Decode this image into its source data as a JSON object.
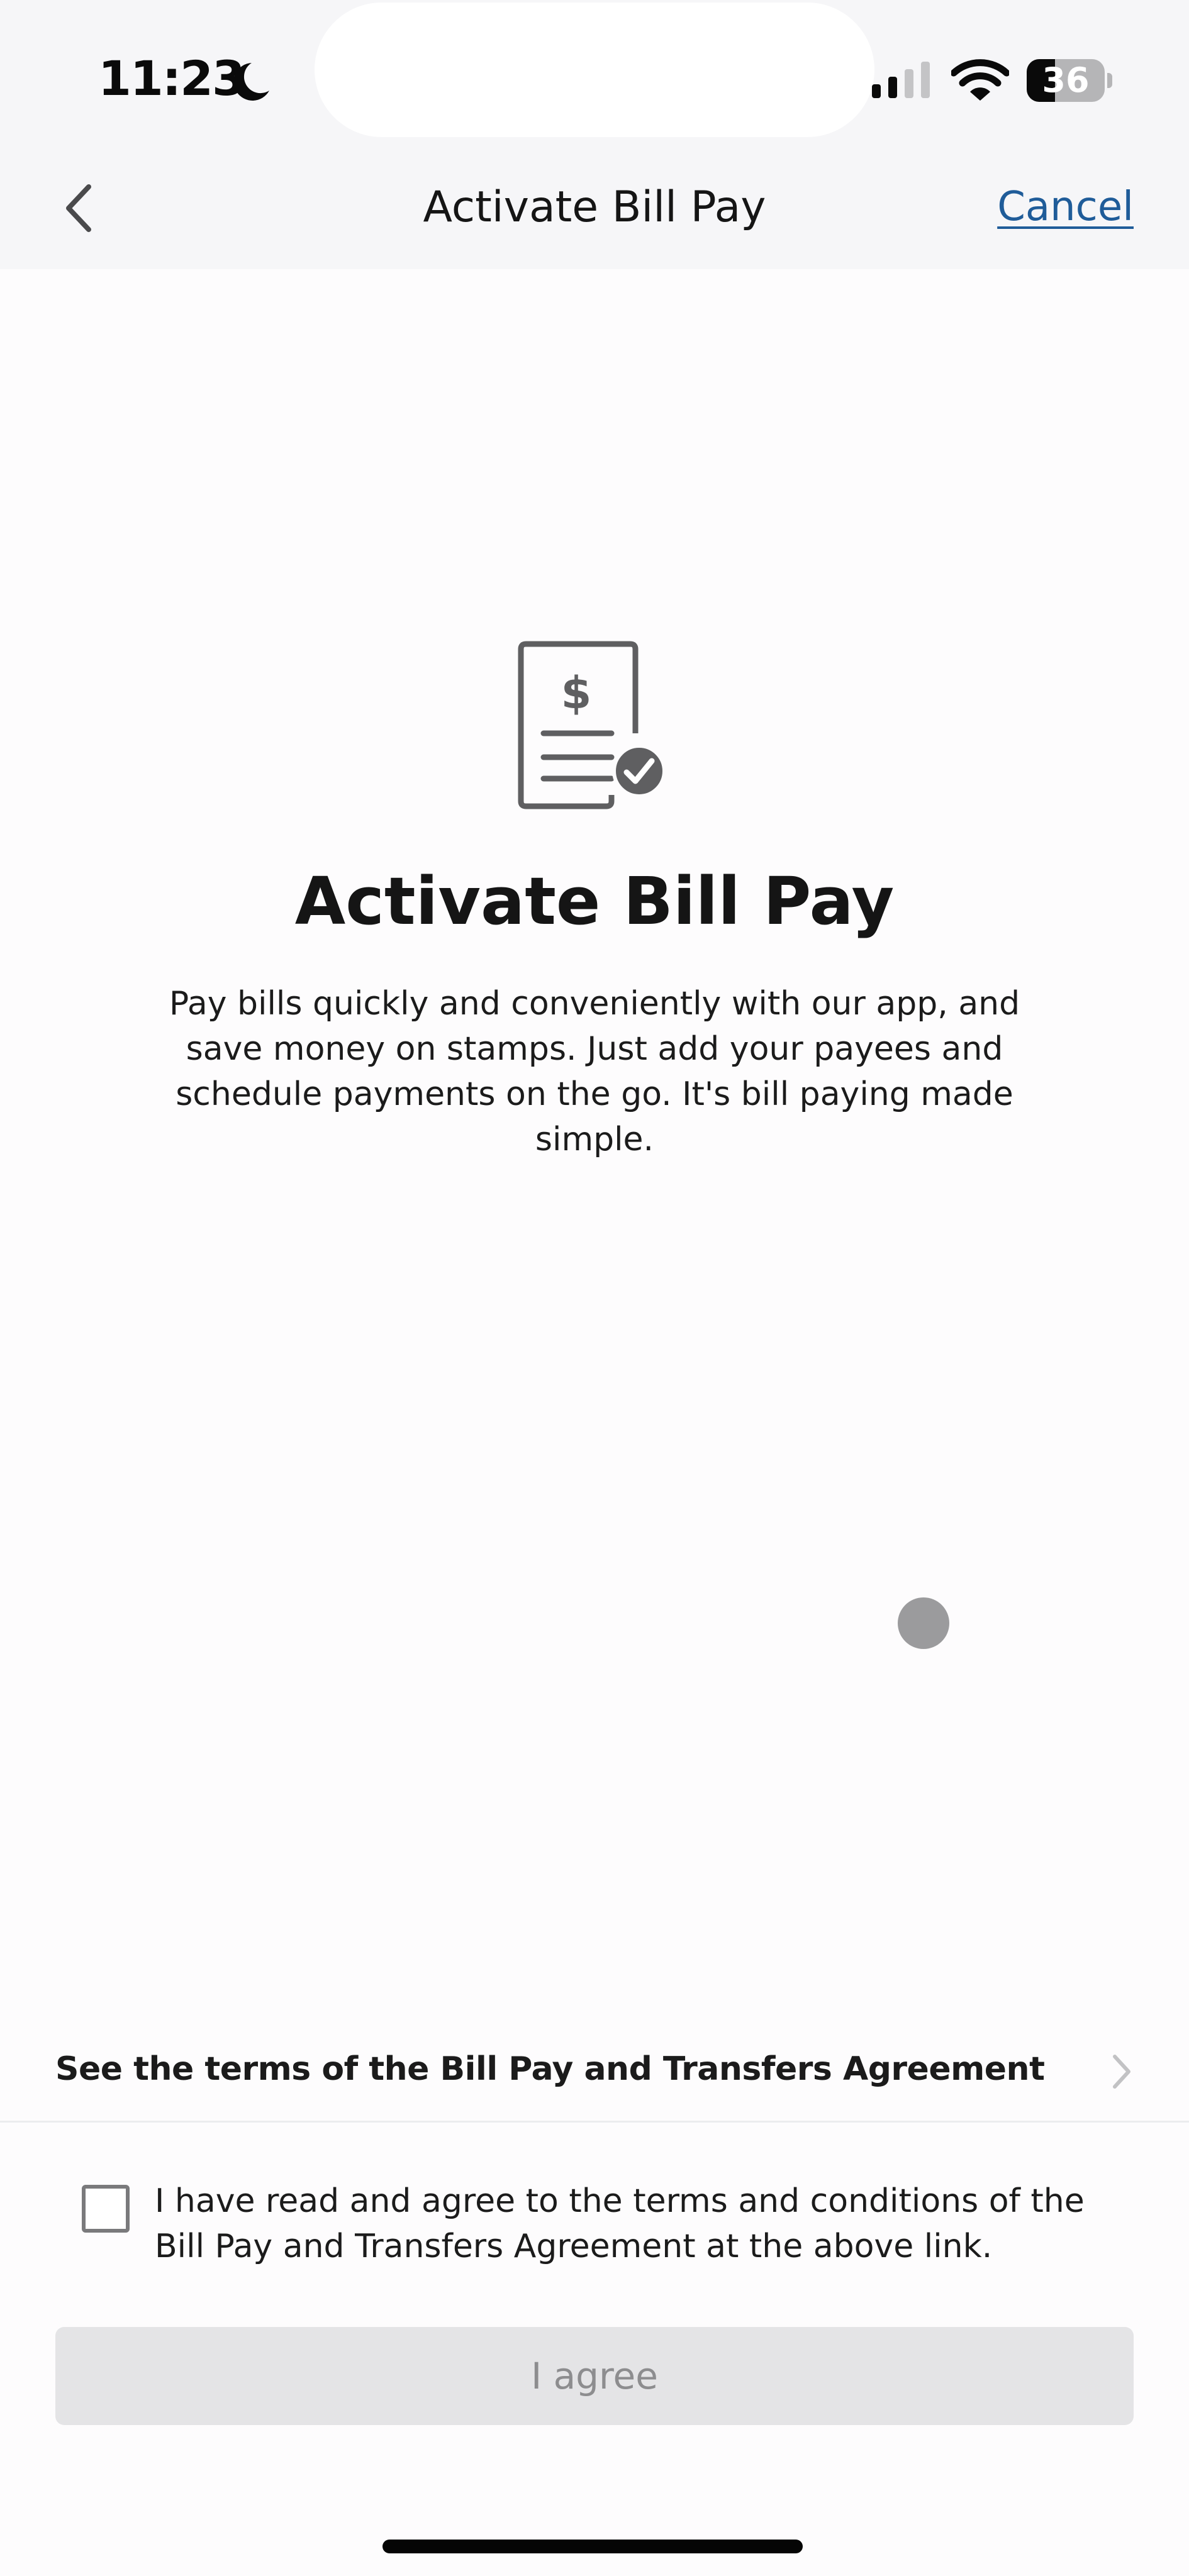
{
  "status_bar": {
    "time": "11:23",
    "focus_mode_icon": "moon-icon",
    "signal_bars_active": 2,
    "signal_bars_total": 4,
    "wifi_icon": "wifi-icon",
    "battery_percent": 36,
    "battery_label": "36"
  },
  "header": {
    "back_icon": "chevron-left-icon",
    "title": "Activate Bill Pay",
    "cancel_label": "Cancel"
  },
  "hero": {
    "icon": "bill-check-icon",
    "title": "Activate Bill Pay",
    "description": "Pay bills quickly and conveniently with our app, and save money on stamps. Just add your payees and schedule payments on the go. It's bill paying made simple."
  },
  "terms": {
    "link_label": "See the terms of the Bill Pay and Transfers Agreement",
    "chevron_icon": "chevron-right-icon"
  },
  "agreement": {
    "checked": false,
    "label": "I have read and agree to the terms and conditions of the Bill Pay and Transfers Agreement at the above link."
  },
  "actions": {
    "agree_label": "I agree",
    "agree_enabled": false
  },
  "colors": {
    "link": "#1f5c99",
    "header_bg": "#f6f6f8",
    "page_bg": "#fdfcfd",
    "icon_gray": "#5f5f61",
    "button_disabled_bg": "#e4e4e6",
    "button_disabled_text": "#8d8d8f"
  }
}
